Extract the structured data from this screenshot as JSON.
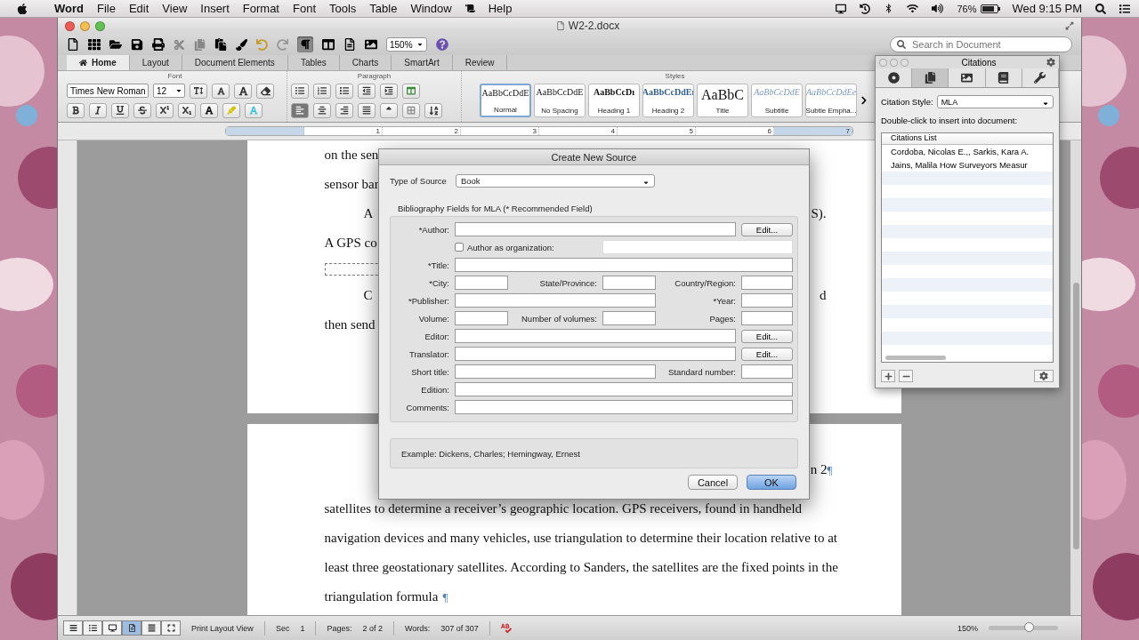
{
  "menu_bar": {
    "app": "Word",
    "items": [
      "File",
      "Edit",
      "View",
      "Insert",
      "Format",
      "Font",
      "Tools",
      "Table",
      "Window"
    ],
    "last_item": "Help",
    "battery": "76%",
    "clock": "Wed 9:15 PM"
  },
  "window": {
    "title": "W2-2.docx"
  },
  "toolbar": {
    "show_formatting": true,
    "zoom": "150%",
    "search": {
      "placeholder": "Search in Document"
    }
  },
  "ribbon": {
    "tabs": [
      {
        "label": "Home",
        "selected": true
      },
      {
        "label": "Layout",
        "selected": false
      },
      {
        "label": "Document Elements",
        "selected": false
      },
      {
        "label": "Tables",
        "selected": false
      },
      {
        "label": "Charts",
        "selected": false
      },
      {
        "label": "SmartArt",
        "selected": false
      },
      {
        "label": "Review",
        "selected": false
      }
    ],
    "groups": [
      "Font",
      "Paragraph",
      "Styles"
    ],
    "font": {
      "name": "Times New Roman",
      "size": "12"
    },
    "alignments": [
      {
        "selected": true
      },
      {
        "selected": false
      },
      {
        "selected": false
      },
      {
        "selected": false
      }
    ],
    "styles": [
      {
        "preview": "AaBbCcDdE",
        "name": "Normal",
        "selected": true
      },
      {
        "preview": "AaBbCcDdE",
        "name": "No Spacing",
        "selected": false
      },
      {
        "preview": "AaBbCcDı",
        "name": "Heading 1",
        "selected": false
      },
      {
        "preview": "AaBbCcDdEı",
        "name": "Heading 2",
        "selected": false
      },
      {
        "preview": "AaBbC",
        "name": "Title",
        "selected": false
      },
      {
        "preview": "AaBbCcDdE",
        "name": "Subtitle",
        "selected": false
      },
      {
        "preview": "AaBbCcDdEe",
        "name": "Subtle Empha...",
        "selected": false
      }
    ]
  },
  "ruler": {
    "numbers": [
      "1",
      "2",
      "3",
      "4",
      "5",
      "6",
      "7"
    ]
  },
  "document": {
    "page_1": [
      {
        "kind": "text",
        "left": "on the sen"
      },
      {
        "kind": "text",
        "left": "sensor bar"
      },
      {
        "kind": "indented",
        "left": "A",
        "right": "S)."
      },
      {
        "kind": "text",
        "left": "A GPS co"
      },
      {
        "kind": "frame"
      },
      {
        "kind": "indented",
        "left": "C",
        "right": "d"
      },
      {
        "kind": "text",
        "left": "then send"
      }
    ],
    "page_2_header": "n 2",
    "page_2": [
      {
        "kind": "text",
        "left": "satellites to determine a receiver’s geographic location. GPS receivers, found in handheld"
      },
      {
        "kind": "text",
        "left": "navigation devices and many vehicles, use triangulation to determine their location relative to at"
      },
      {
        "kind": "text",
        "left": "least three geostationary satellites. According to Sanders, the satellites are the fixed points in the"
      },
      {
        "kind": "last",
        "left": "triangulation formula"
      }
    ],
    "pilcrow": "¶"
  },
  "citations_panel": {
    "title": "Citations",
    "tabs": [
      {
        "selected": false
      },
      {
        "selected": true
      },
      {
        "selected": false
      },
      {
        "selected": false
      },
      {
        "selected": false
      }
    ],
    "style_label": "Citation Style:",
    "style": "MLA",
    "hint": "Double-click to insert into document:",
    "list_header": "Citations List",
    "items": [
      "Cordoba, Nicolas E.,,  Sarkis, Kara A.",
      "Jains, Malila How Surveyors Measur"
    ]
  },
  "dialog": {
    "title": "Create New Source",
    "type_label": "Type of Source",
    "type": "Book",
    "group_label": "Bibliography Fields for MLA  (* Recommended Field)",
    "rows": [
      {
        "kind": "edit",
        "labels": [
          "*Author:"
        ],
        "button": "Edit..."
      },
      {
        "kind": "check",
        "labels": [
          "Author as organization:"
        ],
        "checked": false
      },
      {
        "kind": "full",
        "labels": [
          "*Title:"
        ]
      },
      {
        "kind": "three",
        "labels": [
          "*City:",
          "State/Province:",
          "Country/Region:"
        ]
      },
      {
        "kind": "two",
        "labels": [
          "*Publisher:",
          "*Year:"
        ]
      },
      {
        "kind": "three",
        "labels": [
          "Volume:",
          "Number of volumes:",
          "Pages:"
        ]
      },
      {
        "kind": "edit",
        "labels": [
          "Editor:"
        ],
        "button": "Edit..."
      },
      {
        "kind": "edit",
        "labels": [
          "Translator:"
        ],
        "button": "Edit..."
      },
      {
        "kind": "two",
        "labels": [
          "Short title:",
          "Standard number:"
        ]
      },
      {
        "kind": "full",
        "labels": [
          "Edition:"
        ]
      },
      {
        "kind": "full",
        "labels": [
          "Comments:"
        ]
      }
    ],
    "example": "Example: Dickens, Charles; Hemingway, Ernest",
    "buttons": [
      {
        "label": "Cancel",
        "default": false
      },
      {
        "label": "OK",
        "default": true
      }
    ]
  },
  "status_bar": {
    "views": [
      {
        "selected": false
      },
      {
        "selected": false
      },
      {
        "selected": false
      },
      {
        "selected": true
      },
      {
        "selected": false
      },
      {
        "selected": false
      }
    ],
    "view_label": "Print Layout View",
    "section_label": "Sec",
    "section": "1",
    "pages_label": "Pages:",
    "pages": "2 of 2",
    "words_label": "Words:",
    "words": "307 of 307",
    "zoom": "150%",
    "zoom_slider": {
      "level": 0.58
    }
  }
}
